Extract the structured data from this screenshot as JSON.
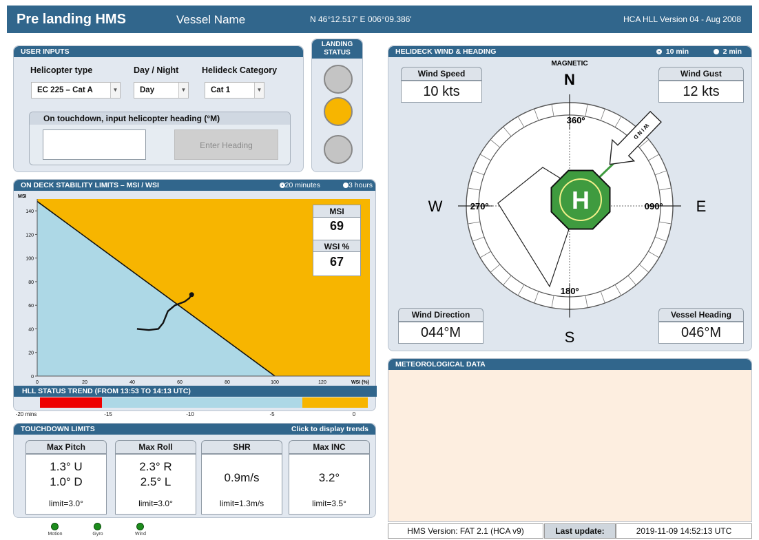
{
  "header": {
    "app_title": "Pre landing HMS",
    "vessel_name": "Vessel Name",
    "position": "N 46°12.517'   E 006°09.386'",
    "version": "HCA HLL Version 04 - Aug 2008"
  },
  "user_inputs": {
    "title": "USER INPUTS",
    "helicopter_type_label": "Helicopter type",
    "helicopter_type_value": "EC 225 – Cat A",
    "day_night_label": "Day / Night",
    "day_night_value": "Day",
    "helideck_category_label": "Helideck Category",
    "helideck_category_value": "Cat 1",
    "heading_group_label": "On touchdown, input helicopter heading (°M)",
    "heading_input_value": "",
    "enter_heading_button": "Enter Heading"
  },
  "landing_status": {
    "title_line1": "LANDING",
    "title_line2": "STATUS",
    "lights": [
      "off",
      "amber",
      "off"
    ],
    "colors": {
      "off": "#c4c4c4",
      "amber": "#f7b500"
    }
  },
  "stability": {
    "title": "ON DECK STABILITY LIMITS – MSI / WSI",
    "radio_20": "20 minutes",
    "radio_3h": "3 hours",
    "msi_label": "MSI",
    "msi_value": "69",
    "wsi_label": "WSI %",
    "wsi_value": "67"
  },
  "chart_data": {
    "type": "line",
    "ylabel": "MSI",
    "xlabel": "WSI (%)",
    "xlim": [
      0,
      140
    ],
    "ylim": [
      0,
      150
    ],
    "xticks": [
      0,
      20,
      40,
      60,
      80,
      100,
      120
    ],
    "yticks": [
      0,
      20,
      40,
      60,
      80,
      100,
      120,
      140
    ],
    "limit_line": [
      [
        0,
        148
      ],
      [
        100,
        0
      ]
    ],
    "trend": [
      [
        42,
        40
      ],
      [
        47,
        39
      ],
      [
        51,
        40
      ],
      [
        53,
        45
      ],
      [
        55,
        55
      ],
      [
        58,
        60
      ],
      [
        62,
        63
      ],
      [
        64,
        66
      ],
      [
        65,
        69
      ]
    ],
    "current_point": [
      65,
      69
    ],
    "colors": {
      "safe": "#add8e6",
      "limit": "#f7b500"
    }
  },
  "hll_trend": {
    "title": "HLL STATUS TREND  (FROM 13:53 TO 14:13 UTC)",
    "ticks": [
      "-20 mins",
      "-15",
      "-10",
      "-5",
      "0"
    ],
    "segments": [
      {
        "from": 0.0,
        "to": 0.19,
        "color": "#ee0000"
      },
      {
        "from": 0.19,
        "to": 0.8,
        "color": "#add8e6"
      },
      {
        "from": 0.8,
        "to": 1.0,
        "color": "#f7b500"
      }
    ]
  },
  "touchdown": {
    "title": "TOUCHDOWN LIMITS",
    "trend_link": "Click to display trends",
    "cards": [
      {
        "label": "Max Pitch",
        "line1": "1.3° U",
        "line2": "1.0° D",
        "limit": "limit=3.0°"
      },
      {
        "label": "Max Roll",
        "line1": "2.3° R",
        "line2": "2.5° L",
        "limit": "limit=3.0°"
      },
      {
        "label": "SHR",
        "line1": "0.9m/s",
        "line2": "",
        "limit": "limit=1.3m/s"
      },
      {
        "label": "Max INC",
        "line1": "3.2°",
        "line2": "",
        "limit": "limit=3.5°"
      }
    ]
  },
  "status_leds": [
    {
      "label": "Motion"
    },
    {
      "label": "Gyro"
    },
    {
      "label": "Wind"
    }
  ],
  "wind": {
    "title": "HELIDECK WIND & HEADING",
    "radio_10": "10 min",
    "radio_2": "2 min",
    "magnetic_label": "MAGNETIC",
    "wind_speed_label": "Wind Speed",
    "wind_speed_value": "10 kts",
    "wind_gust_label": "Wind Gust",
    "wind_gust_value": "12 kts",
    "wind_direction_label": "Wind Direction",
    "wind_direction_value": "044°M",
    "vessel_heading_label": "Vessel Heading",
    "vessel_heading_value": "046°M",
    "wind_direction_deg": 44,
    "vessel_heading_deg": 46,
    "compass_n": "N",
    "compass_e": "E",
    "compass_s": "S",
    "compass_w": "W",
    "deg_360": "360º",
    "deg_090": "090º",
    "deg_180": "180º",
    "deg_270": "270º",
    "wind_arrow_text": "W I N D",
    "helideck_symbol": "H"
  },
  "met": {
    "title": "METEOROLOGICAL DATA",
    "bg_color": "#fdeee0"
  },
  "footer": {
    "hms_version": "HMS Version: FAT 2.1 (HCA v9)",
    "last_update_label": "Last update:",
    "last_update_value": "2019-11-09 14:52:13 UTC"
  }
}
